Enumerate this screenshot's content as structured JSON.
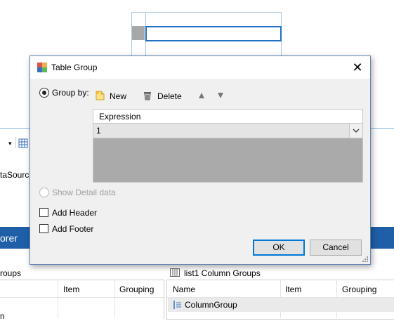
{
  "background": {
    "datasource_fragment": "taSource",
    "explorer_fragment": "orer",
    "row_groups_fragment": "roups",
    "row_groups_columns": [
      "Item",
      "Grouping"
    ],
    "column_groups_title": "list1 Column Groups",
    "column_groups_columns": [
      "Name",
      "Item",
      "Grouping"
    ],
    "column_group_row": "ColumnGroup",
    "bottom_fragment": "n"
  },
  "dialog": {
    "title": "Table Group",
    "group_by_label": "Group by:",
    "new_label": "New",
    "delete_label": "Delete",
    "expression_header": "Expression",
    "expression_value": "1",
    "show_detail_label": "Show Detail data",
    "add_header_label": "Add Header",
    "add_footer_label": "Add Footer",
    "ok_label": "OK",
    "cancel_label": "Cancel"
  },
  "icons": {
    "close": "close-icon",
    "app": "table-group-icon",
    "new": "new-document-icon",
    "delete": "trash-icon",
    "up": "arrow-up-icon",
    "down": "arrow-down-icon",
    "grid": "grid-icon",
    "column_groups": "column-groups-icon",
    "group_row": "group-icon"
  },
  "colors": {
    "accent": "#0078d7",
    "explorer_bar": "#1f5fa8"
  }
}
